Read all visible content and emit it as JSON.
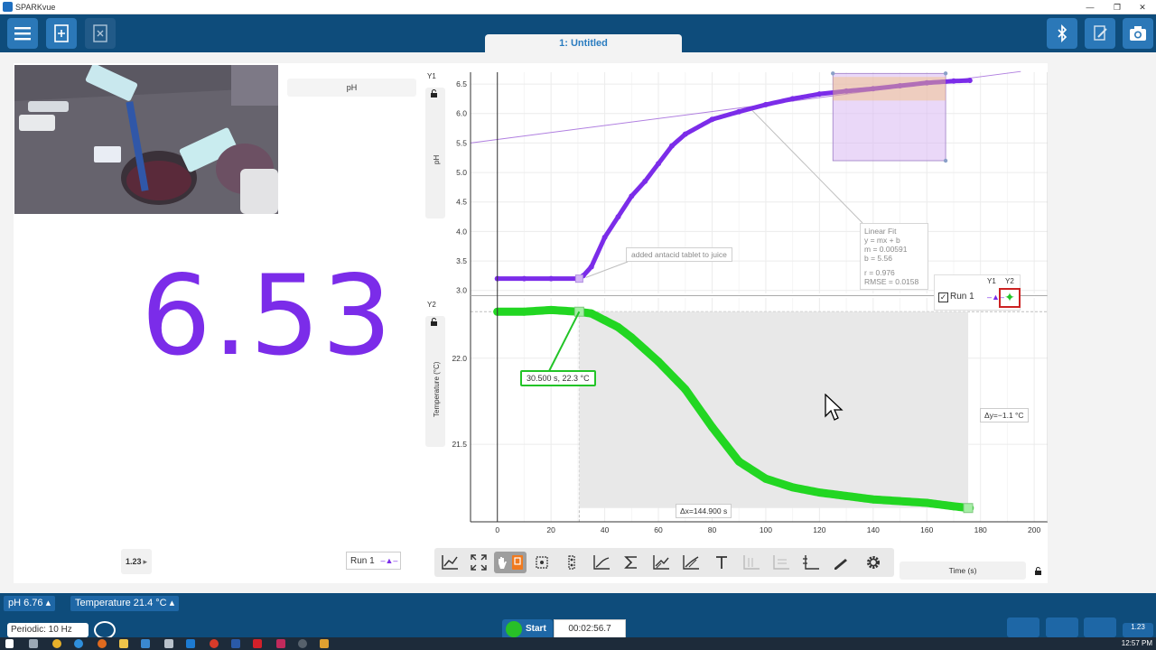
{
  "window": {
    "title": "SPARKvue",
    "min": "—",
    "restore": "❐",
    "close": "✕"
  },
  "page_tab": {
    "label": "1: Untitled"
  },
  "sensor_label": "pH",
  "digits": {
    "value": "6.53"
  },
  "graph": {
    "y1_id": "Y1",
    "y2_id": "Y2",
    "y1_label": "pH",
    "y2_label": "Temperature (°C)",
    "x_label": "Time (s)",
    "x_ticks": [
      "0",
      "20",
      "40",
      "60",
      "80",
      "100",
      "120",
      "140",
      "160",
      "180",
      "200"
    ],
    "y1_ticks": [
      "6.5",
      "6.0",
      "5.5",
      "5.0",
      "4.5",
      "4.0",
      "3.5",
      "3.0"
    ],
    "y2_ticks": [
      "22.0",
      "21.5"
    ]
  },
  "annotation": {
    "text": "added antacid tablet to juice"
  },
  "coord": {
    "text": "30.500 s, 22.3 °C"
  },
  "fit": {
    "title": "Linear Fit",
    "eq": "y = mx + b",
    "m": "m = 0.00591",
    "b": "b = 5.56",
    "r": "r = 0.976",
    "rmse": "RMSE = 0.0158"
  },
  "delta": {
    "dy": "Δy=−1.1 °C",
    "dx": "Δx=144.900 s"
  },
  "legend": {
    "y1": "Y1",
    "y2": "Y2",
    "check": "✓",
    "run": "Run 1",
    "y1_mark": "–▲–",
    "y2_mark": "✦"
  },
  "run_selector": {
    "label": "Run 1",
    "mark": "–▲–"
  },
  "digits_btn": {
    "label": "1.23",
    "arrow": "▸"
  },
  "status": {
    "ph": "pH  6.76  ▴",
    "temp": "Temperature  21.4 °C  ▴"
  },
  "controls": {
    "periodic": "Periodic: 10 Hz",
    "start": "Start",
    "timer": "00:02:56.7",
    "digits_corner": "1.23"
  },
  "taskbar": {
    "clock": "12:57 PM"
  },
  "chart_data": [
    {
      "type": "scatter",
      "series": [
        {
          "name": "Run 1",
          "x": [
            0,
            10,
            20,
            30,
            32,
            35,
            40,
            45,
            50,
            55,
            60,
            65,
            70,
            80,
            90,
            100,
            110,
            120,
            130,
            140,
            150,
            160,
            170,
            176
          ],
          "y": [
            3.2,
            3.2,
            3.2,
            3.2,
            3.25,
            3.4,
            3.9,
            4.25,
            4.6,
            4.85,
            5.15,
            5.45,
            5.65,
            5.9,
            6.03,
            6.15,
            6.25,
            6.33,
            6.38,
            6.42,
            6.47,
            6.52,
            6.55,
            6.56
          ]
        }
      ],
      "ylabel": "pH",
      "xlabel": "Time (s)",
      "xlim": [
        -10,
        205
      ],
      "ylim": [
        2.95,
        6.7
      ],
      "grid": true
    },
    {
      "type": "scatter",
      "series": [
        {
          "name": "Run 1",
          "x": [
            0,
            10,
            20,
            30,
            35,
            40,
            45,
            50,
            55,
            60,
            70,
            80,
            90,
            100,
            110,
            120,
            130,
            140,
            150,
            160,
            170,
            176
          ],
          "y": [
            22.27,
            22.27,
            22.28,
            22.27,
            22.26,
            22.22,
            22.18,
            22.12,
            22.05,
            21.98,
            21.82,
            21.6,
            21.4,
            21.3,
            21.25,
            21.22,
            21.2,
            21.18,
            21.17,
            21.16,
            21.14,
            21.13
          ]
        }
      ],
      "ylabel": "Temperature (°C)",
      "xlabel": "Time (s)",
      "xlim": [
        -10,
        205
      ],
      "ylim": [
        21.05,
        22.35
      ],
      "grid": true
    }
  ]
}
